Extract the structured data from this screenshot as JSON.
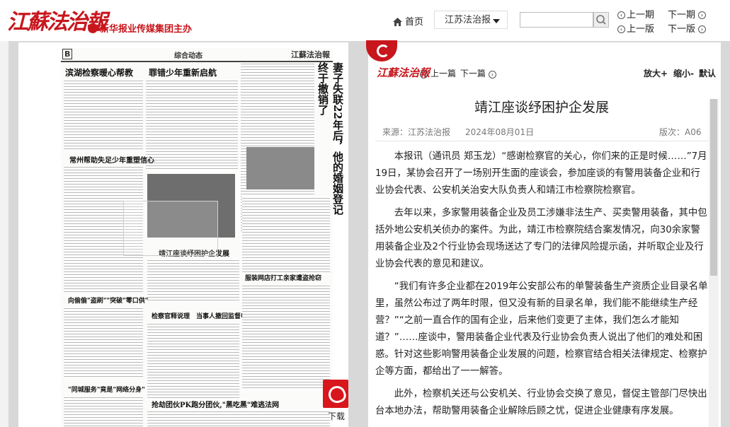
{
  "header": {
    "logo": "江蘇法治報",
    "org": "新华报业传媒集团主办",
    "home": "首页",
    "paper_select": "江苏法治报",
    "prev_issue": "上一期",
    "next_issue": "下一期",
    "prev_page": "上一版",
    "next_page": "下一版",
    "brand_color": "#c8161d"
  },
  "newspaper": {
    "page_letter": "B",
    "section": "综合动态",
    "brand": "江蘇法治報",
    "headlines": {
      "h1": "滨湖检察暖心帮教",
      "h2": "罪错少年重新启航",
      "h3": "常州帮助失足少年重塑信心",
      "h4": "靖江座谈纾困护企发展",
      "h5": "检察官释说理　当事人撤回监督申请",
      "h6": "向偷偷\"盗刷\"\"突破\"零口供\"",
      "h7": "\"同城服务\"竟是\"网络分身\"",
      "h8": "抢劫团伙PK跑分团伙,\"黑吃黑\"难逃法网",
      "h9": "服装网店打工亲家遭盗抢窃",
      "vertical": "妻子失联22年后，他的婚姻登记终于撤销了"
    }
  },
  "download": "下载",
  "article": {
    "mini_logo": "江蘇法治報",
    "prev_article": "上一篇",
    "next_article": "下一篇",
    "zoom_in": "放大+",
    "zoom_out": "缩小-",
    "zoom_default": "默认",
    "title": "靖江座谈纾困护企发展",
    "source": "来源：江苏法治报",
    "date": "2024年08月01日",
    "edition": "版次：A06",
    "paragraphs": [
      "本报讯（通讯员 郑玉龙）“感谢检察官的关心，你们来的正是时候……”7月19日，某协会召开了一场别开生面的座谈会，参加座谈的有警用装备企业和行业协会代表、公安机关治安大队负责人和靖江市检察院检察官。",
      "去年以来，多家警用装备企业及员工涉嫌非法生产、买卖警用装备，其中包括外地公安机关侦办的案件。为此，靖江市检察院结合案发情况，向30余家警用装备企业及2个行业协会现场送达了专门的法律风险提示函，并听取企业及行业协会代表的意见和建议。",
      "“我们有许多企业都在2019年公安部公布的单警装备生产资质企业目录名单里，虽然公布过了两年时限，但又没有新的目录名单，我们能不能继续生产经营？”“之前一直合作的国有企业，后来他们变更了主体，我们怎么才能知道？”……座谈中，警用装备企业代表及行业协会负责人说出了他们的难处和困惑。针对这些影响警用装备企业发展的问题，检察官结合相关法律规定、检察护企等方面，都给出了一一解答。",
      "此外，检察机关还与公安机关、行业协会交换了意见，督促主管部门尽快出台本地办法，帮助警用装备企业解除后顾之忧，促进企业健康有序发展。"
    ]
  }
}
